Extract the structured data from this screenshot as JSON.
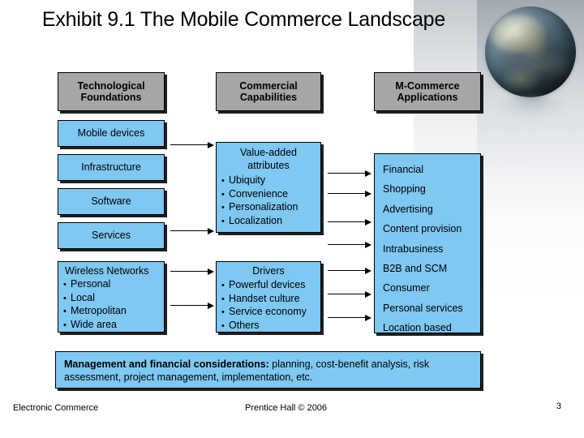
{
  "slide": {
    "title": "Exhibit 9.1 The Mobile Commerce Landscape"
  },
  "columns": {
    "left_header": "Technological Foundations",
    "middle_header": "Commercial Capabilities",
    "right_header": "M-Commerce Applications"
  },
  "technological_foundations": {
    "boxes": [
      {
        "label": "Mobile devices"
      },
      {
        "label": "Infrastructure"
      },
      {
        "label": "Software"
      },
      {
        "label": "Services"
      }
    ],
    "wireless_networks": {
      "title": "Wireless Networks",
      "items": [
        "Personal",
        "Local",
        "Metropolitan",
        "Wide area"
      ]
    }
  },
  "commercial_capabilities": {
    "value_added": {
      "title_line1": "Value-added",
      "title_line2": "attributes",
      "items": [
        "Ubiquity",
        "Convenience",
        "Personalization",
        "Localization"
      ]
    },
    "drivers": {
      "title": "Drivers",
      "items": [
        "Powerful devices",
        "Handset culture",
        "Service economy",
        "Others"
      ]
    }
  },
  "m_commerce_applications": {
    "items": [
      "Financial",
      "Shopping",
      "Advertising",
      "Content provision",
      "Intrabusiness",
      "B2B and SCM",
      "Consumer",
      "Personal services",
      "Location based"
    ]
  },
  "bottom_bar": {
    "lead": "Management and financial considerations:",
    "rest": " planning, cost-benefit analysis, risk assessment, project management, implementation, etc."
  },
  "footer": {
    "left": "Electronic Commerce",
    "center": "Prentice Hall © 2006",
    "page": "3"
  },
  "colors": {
    "blue_box": "#7ec8f2",
    "header_box": "#a6a6a6",
    "border": "#000000"
  }
}
